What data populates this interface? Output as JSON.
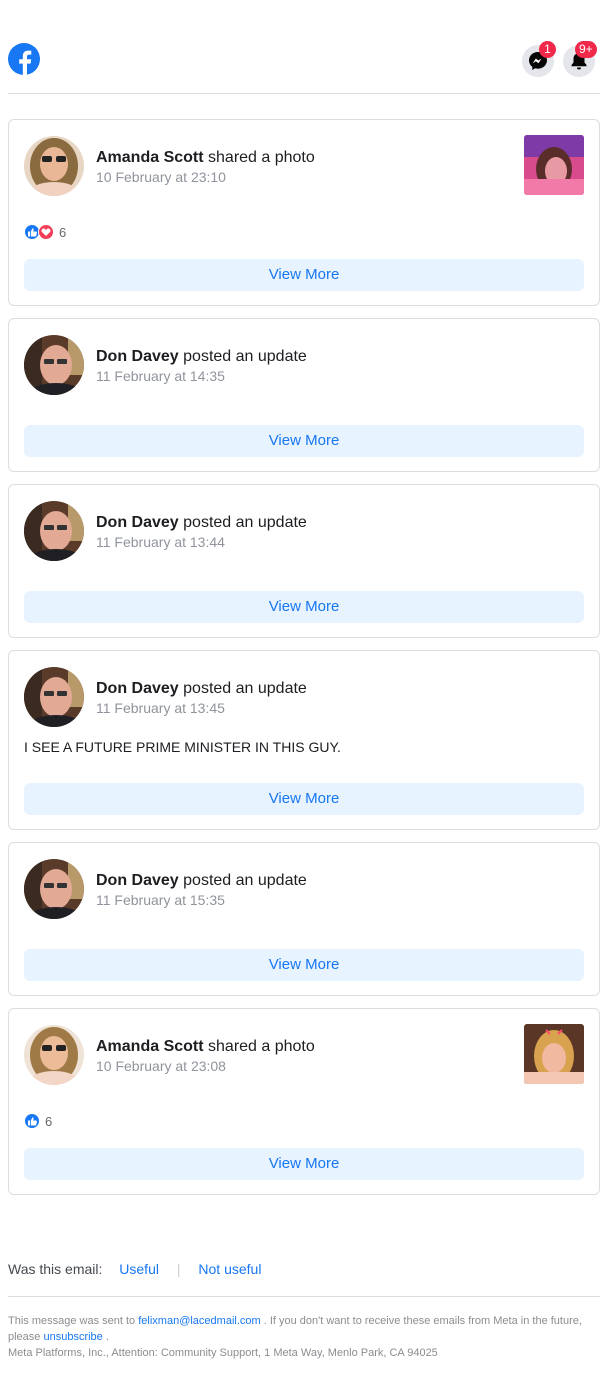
{
  "header": {
    "logo": "facebook-logo",
    "messenger_badge": "1",
    "notifications_badge": "9+"
  },
  "cards": [
    {
      "name": "Amanda Scott",
      "action": " shared a photo",
      "time": "10 February at 23:10",
      "has_thumb": true,
      "reactions": [
        "like",
        "love"
      ],
      "reaction_count": "6",
      "button": "View More"
    },
    {
      "name": "Don Davey",
      "action": " posted an update",
      "time": "11 February at 14:35",
      "button": "View More"
    },
    {
      "name": "Don Davey",
      "action": " posted an update",
      "time": "11 February at 13:44",
      "button": "View More"
    },
    {
      "name": "Don Davey",
      "action": " posted an update",
      "time": "11 February at 13:45",
      "text": "I SEE A FUTURE PRIME MINISTER IN THIS GUY.",
      "button": "View More"
    },
    {
      "name": "Don Davey",
      "action": " posted an update",
      "time": "11 February at 15:35",
      "button": "View More"
    },
    {
      "name": "Amanda Scott",
      "action": " shared a photo",
      "time": "10 February at 23:08",
      "has_thumb": true,
      "reactions": [
        "like"
      ],
      "reaction_count": "6",
      "button": "View More"
    }
  ],
  "feedback": {
    "prompt": "Was this email:",
    "useful": "Useful",
    "separator": "|",
    "not_useful": "Not useful"
  },
  "footer": {
    "sent_prefix": "This message was sent to ",
    "email": "felixman@lacedmail.com",
    "sent_suffix": " . If you don't want to receive these emails from Meta in the future, please ",
    "unsubscribe": "unsubscribe",
    "end": " .",
    "address": "Meta Platforms, Inc., Attention: Community Support, 1 Meta Way, Menlo Park, CA 94025"
  }
}
